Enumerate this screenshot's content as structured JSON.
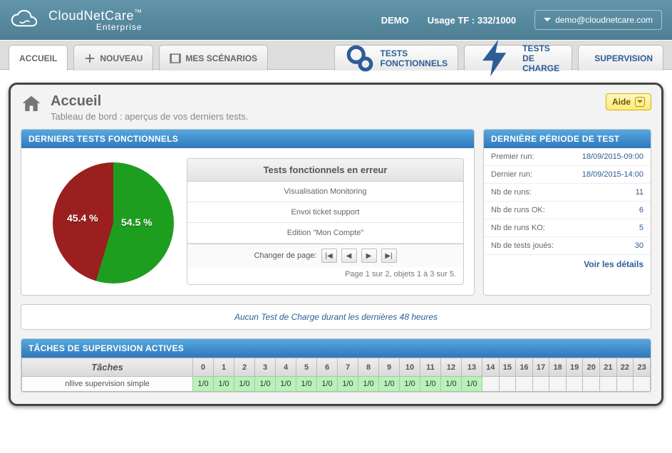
{
  "banner": {
    "brand": "CloudNetCare",
    "brand_tm": "™",
    "brand_sub": "Enterprise",
    "demo": "DEMO",
    "usage_label": "Usage TF :",
    "usage_value": "332/1000",
    "user_email": "demo@cloudnetcare.com"
  },
  "nav": {
    "accueil": "ACCUEIL",
    "nouveau": "NOUVEAU",
    "scenarios": "MES SCÉNARIOS",
    "func": "TESTS FONCTIONNELS",
    "charge": "TESTS DE CHARGE",
    "supervision": "SUPERVISION"
  },
  "page": {
    "title": "Accueil",
    "subtitle": "Tableau de bord : aperçus de vos derniers tests.",
    "help": "Aide"
  },
  "func_panel": {
    "header": "DERNIERS TESTS FONCTIONNELS",
    "errors_header": "Tests fonctionnels en erreur",
    "errors": [
      "Visualisation Monitoring",
      "Envoi ticket support",
      "Edition \"Mon Compte\""
    ],
    "pager_label": "Changer de page:",
    "pager_info": "Page 1 sur 2, objets 1 à 3 sur 5."
  },
  "chart_data": {
    "type": "pie",
    "title": "",
    "series": [
      {
        "name": "KO",
        "value": 45.4,
        "color": "#9b1f1f",
        "label": "45.4 %"
      },
      {
        "name": "OK",
        "value": 54.5,
        "color": "#1e9e1e",
        "label": "54.5 %"
      }
    ]
  },
  "period_panel": {
    "header": "DERNIÈRE PÉRIODE DE TEST",
    "rows": [
      {
        "k": "Premier run:",
        "v": "18/09/2015-09:00"
      },
      {
        "k": "Dernier run:",
        "v": "18/09/2015-14:00"
      },
      {
        "k": "Nb de runs:",
        "v": "11"
      },
      {
        "k": "Nb de runs OK:",
        "v": "6"
      },
      {
        "k": "Nb de runs KO:",
        "v": "5"
      },
      {
        "k": "Nb de tests joués:",
        "v": "30"
      }
    ],
    "details": "Voir les détails"
  },
  "strip": "Aucun Test de Charge durant les dernières 48 heures",
  "supervision": {
    "header": "TÂCHES DE SUPERVISION ACTIVES",
    "task_col": "Tâches",
    "hours": [
      "0",
      "1",
      "2",
      "3",
      "4",
      "5",
      "6",
      "7",
      "8",
      "9",
      "10",
      "11",
      "12",
      "13",
      "14",
      "15",
      "16",
      "17",
      "18",
      "19",
      "20",
      "21",
      "22",
      "23"
    ],
    "rows": [
      {
        "task": "nllive supervision simple",
        "cells": [
          "1/0",
          "1/0",
          "1/0",
          "1/0",
          "1/0",
          "1/0",
          "1/0",
          "1/0",
          "1/0",
          "1/0",
          "1/0",
          "1/0",
          "1/0",
          "1/0",
          "",
          "",
          "",
          "",
          "",
          "",
          "",
          "",
          "",
          ""
        ]
      }
    ]
  }
}
